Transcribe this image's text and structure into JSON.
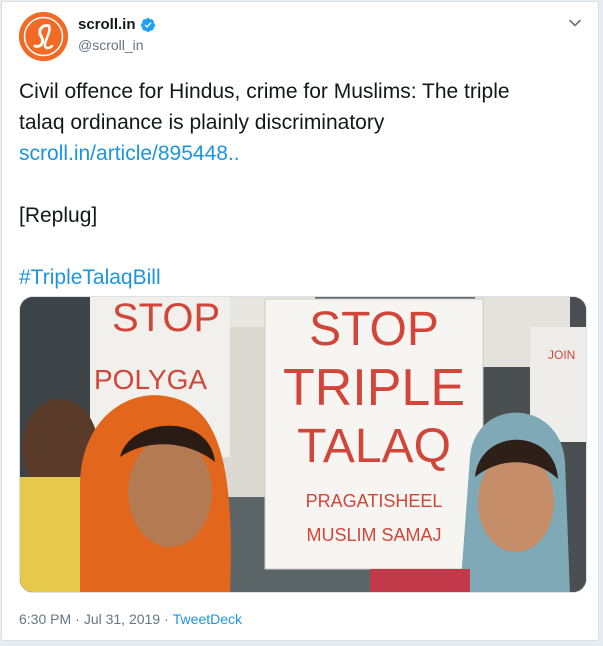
{
  "account": {
    "display_name": "scroll.in",
    "handle": "@scroll_in",
    "verified": true,
    "avatar_icon": "scroll-logo-icon",
    "avatar_color": "#f26a25"
  },
  "tweet": {
    "text_line_1": "Civil offence for Hindus, crime for Muslims: The triple",
    "text_line_2": "talaq ordinance is plainly discriminatory",
    "link_text": "scroll.in/article/895448..",
    "replug": "[Replug]",
    "hashtag": "#TripleTalaqBill",
    "link_color": "#1b95e0"
  },
  "photo": {
    "sign_main_line_1": "STOP",
    "sign_main_line_2": "TRIPLE",
    "sign_main_line_3": "TALAQ",
    "sign_main_line_4": "PRAGATISHEEL",
    "sign_main_line_5": "MUSLIM SAMAJ",
    "sign_left_line_1": "STOP",
    "sign_left_line_2": "POLYGA",
    "sign_right_text": "JOIN"
  },
  "footer": {
    "time": "6:30 PM",
    "separator": "·",
    "date": "Jul 31, 2019",
    "source": "TweetDeck"
  }
}
